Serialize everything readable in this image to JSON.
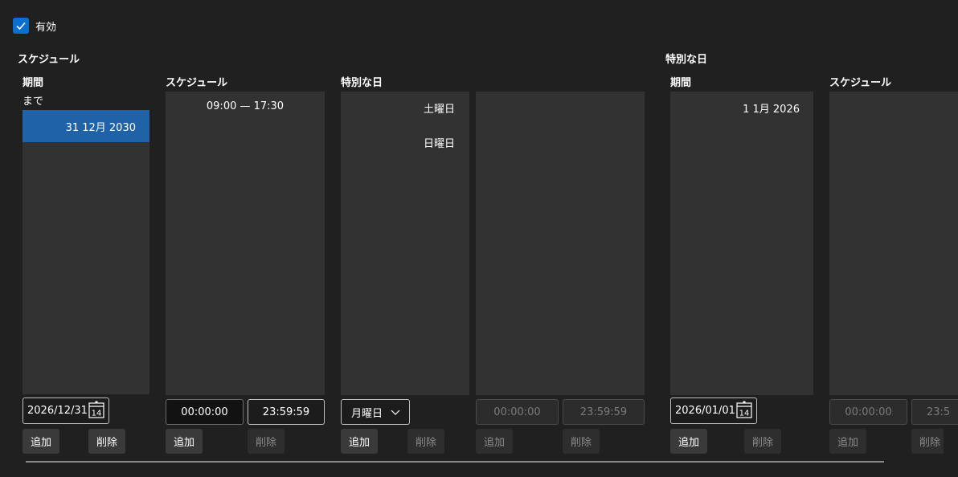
{
  "enabled": {
    "label": "有効",
    "checked": true
  },
  "schedule_section": {
    "title": "スケジュール",
    "period": {
      "header": "期間",
      "until_label": "まで",
      "selected_item": "31 12月 2030",
      "date_value": "2026/12/31",
      "calendar_day": "14",
      "add_label": "追加",
      "delete_label": "削除"
    },
    "schedule": {
      "header": "スケジュール",
      "items": [
        "09:00 — 17:30"
      ],
      "start_time": "00:00:00",
      "end_time": "23:59:59",
      "add_label": "追加",
      "delete_label": "削除"
    },
    "special_days": {
      "header": "特別な日",
      "items": [
        "土曜日",
        "日曜日"
      ],
      "day_select": "月曜日",
      "add_label": "追加",
      "delete_label": "削除"
    },
    "special_times": {
      "start_time": "00:00:00",
      "end_time": "23:59:59",
      "add_label": "追加",
      "delete_label": "削除"
    }
  },
  "special_section": {
    "title": "特別な日",
    "period": {
      "header": "期間",
      "items": [
        "1 1月 2026"
      ],
      "date_value": "2026/01/01",
      "calendar_day": "14",
      "add_label": "追加",
      "delete_label": "削除"
    },
    "schedule": {
      "header": "スケジュール",
      "start_time": "00:00:00",
      "end_time": "23:5",
      "add_label": "追加",
      "delete_label": "削除"
    }
  },
  "colors": {
    "accent": "#0a6fd0",
    "selection": "#1f62a8",
    "panel": "#323232",
    "background": "#202020"
  }
}
